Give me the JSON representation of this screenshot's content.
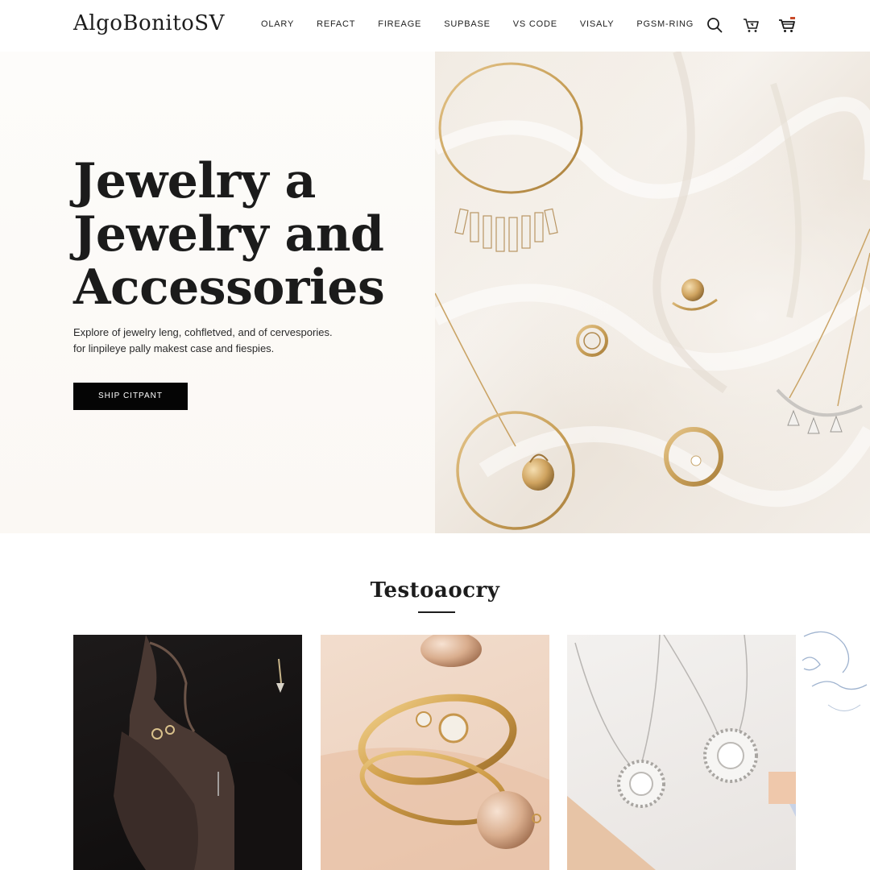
{
  "header": {
    "logo": "AlgoBonitoSV",
    "nav": [
      "OLARY",
      "REFACT",
      "FIREAGE",
      "SUPBASE",
      "VS CODE",
      "VISALY",
      "PGSM-RING"
    ],
    "icons": [
      "search-icon",
      "wishlist-cart-icon",
      "shopping-cart-icon"
    ]
  },
  "hero": {
    "title_lines": [
      "Jewelry a",
      "Jewelry and",
      "Accessories"
    ],
    "desc_line1": "Explore of jewelry leng, cohfletved, and of cervespories.",
    "desc_line2": "for linpileye pally makest case and fiespies.",
    "cta_label": "SHIP CITPANT"
  },
  "section": {
    "title": "Testoaocry"
  },
  "cards": [
    {
      "subject": "model wearing rings and earrings"
    },
    {
      "subject": "gold bangles and pearl"
    },
    {
      "subject": "silver pendant necklaces"
    }
  ],
  "colors": {
    "text": "#1a1a1a",
    "button_bg": "#050505",
    "gold": "#c9a15a",
    "hero_left_bg": "#fbf8f4"
  }
}
